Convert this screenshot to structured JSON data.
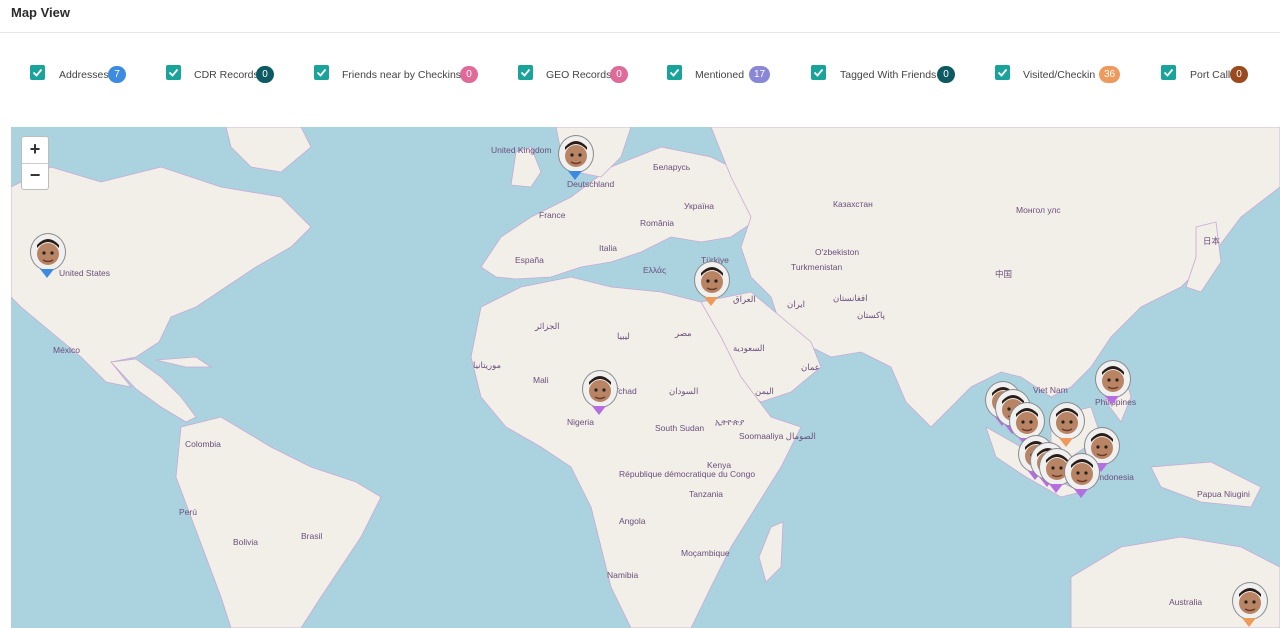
{
  "header": {
    "title": "Map View"
  },
  "filters": [
    {
      "label": "Addresses",
      "count": "7",
      "color": "#3d8be0"
    },
    {
      "label": "CDR Records",
      "count": "0",
      "color": "#0d5a63"
    },
    {
      "label": "Friends near by Checkins",
      "count": "0",
      "color": "#e06b9b"
    },
    {
      "label": "GEO Records",
      "count": "0",
      "color": "#e06b9b"
    },
    {
      "label": "Mentioned",
      "count": "17",
      "color": "#8a87d6"
    },
    {
      "label": "Tagged With Friends",
      "count": "0",
      "color": "#0d5a63"
    },
    {
      "label": "Visited/Checkin",
      "count": "36",
      "color": "#ee9a5c"
    },
    {
      "label": "Port Call",
      "count": "0",
      "color": "#9a4a1e"
    }
  ],
  "map": {
    "zoom_in": "+",
    "zoom_out": "−",
    "labels": [
      "United Kingdom",
      "Deutschland",
      "Беларусь",
      "France",
      "România",
      "Україна",
      "Казахстан",
      "Монгол улс",
      "España",
      "Italia",
      "Ελλάς",
      "Türkiye",
      "O'zbekiston",
      "Turkmenistan",
      "日本",
      "中国",
      "United States",
      "México",
      "الجزائر",
      "ليبيا",
      "مصر",
      "العراق",
      "ایران",
      "افغانستان",
      "پاکستان",
      "السعودية",
      "عمان",
      "اليمن",
      "موريتانيا",
      "Mali",
      "Tchad",
      "السودان",
      "Nigeria",
      "South Sudan",
      "ኢትዮጵያ",
      "Soomaaliya الصومال",
      "Kenya",
      "République démocratique du Congo",
      "Tanzania",
      "Angola",
      "Moçambique",
      "Namibia",
      "Colombia",
      "Perú",
      "Brasil",
      "Bolivia",
      "Viet Nam",
      "Philippines",
      "Indonesia",
      "Papua Niugini",
      "Australia"
    ],
    "marker_colors": {
      "addresses": "#3d8be0",
      "visited": "#ee9a5c",
      "mentioned": "#b56ee0"
    }
  }
}
